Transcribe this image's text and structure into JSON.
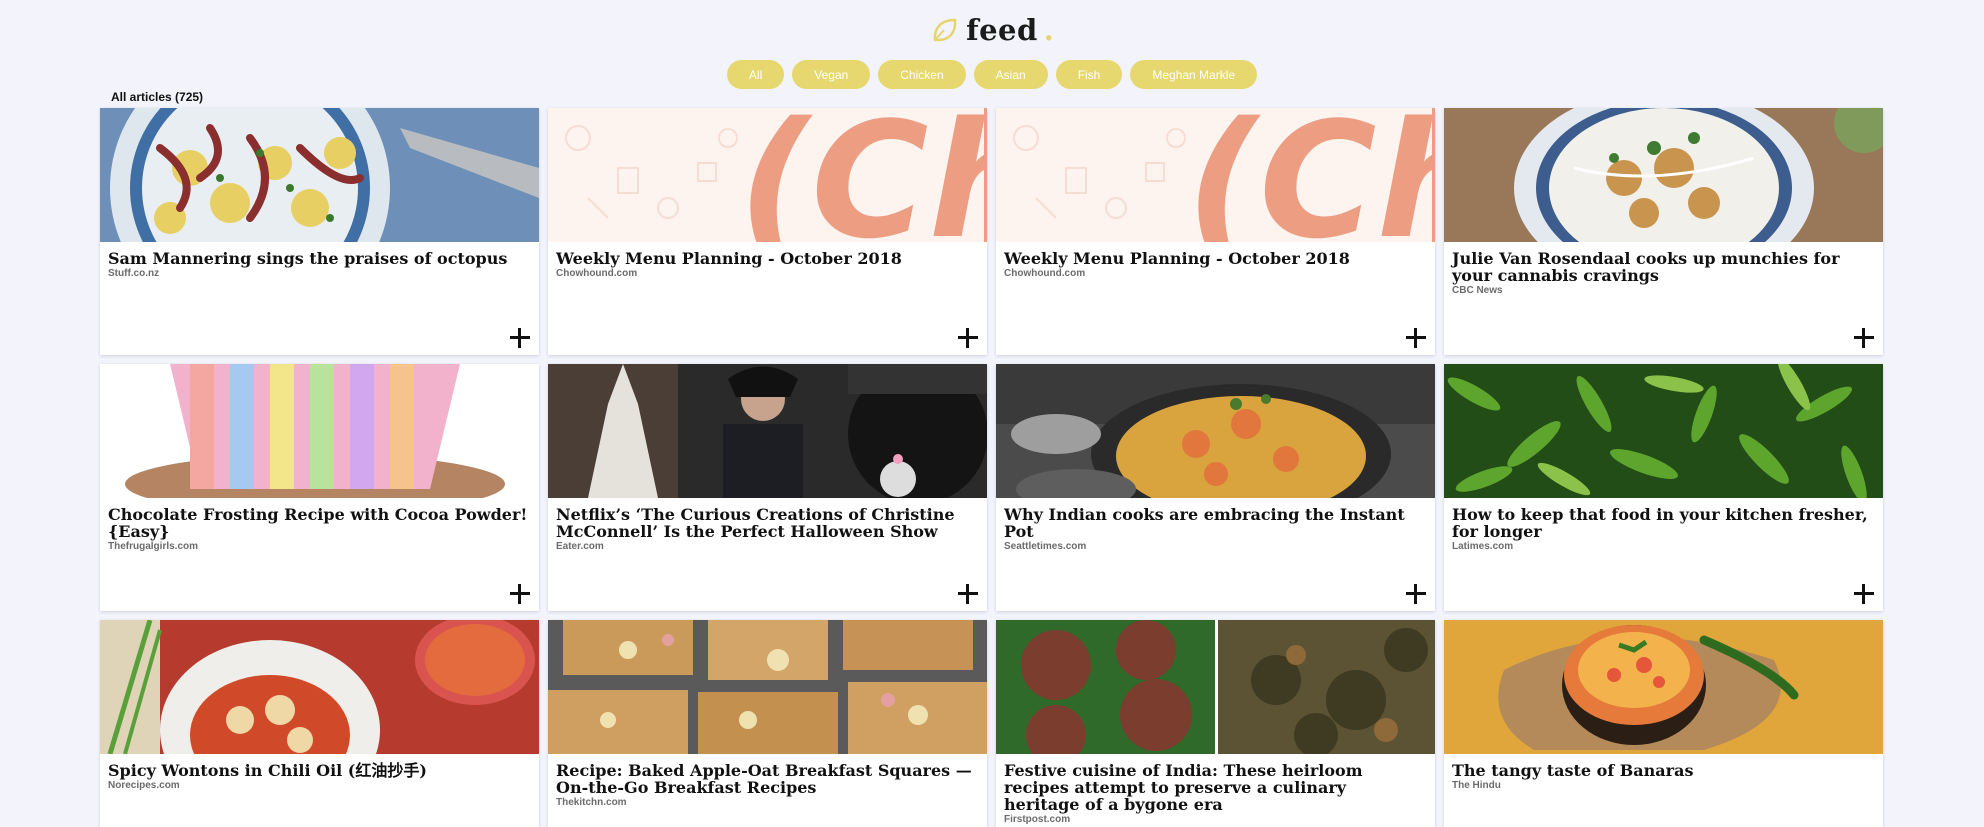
{
  "header": {
    "logo_text": "feed",
    "logo_dot": "."
  },
  "filters": [
    "All",
    "Vegan",
    "Chicken",
    "Asian",
    "Fish",
    "Meghan Markle"
  ],
  "article_count_label": "All articles (725)",
  "colors": {
    "accent": "#e6d86e",
    "background": "#f2f3fb",
    "card": "#ffffff"
  },
  "articles": [
    {
      "title": "Sam Mannering sings the praises of octopus",
      "source": "Stuff.co.nz",
      "image": "octopus-salad"
    },
    {
      "title": "Weekly Menu Planning - October 2018",
      "source": "Chowhound.com",
      "image": "chowhound-logo"
    },
    {
      "title": "Weekly Menu Planning - October 2018",
      "source": "Chowhound.com",
      "image": "chowhound-logo"
    },
    {
      "title": "Julie Van Rosendaal cooks up munchies for your cannabis cravings",
      "source": "CBC News",
      "image": "snack-plate"
    },
    {
      "title": "Chocolate Frosting Recipe with Cocoa Powder! {Easy}",
      "source": "Thefrugalgirls.com",
      "image": "cupcake-liners"
    },
    {
      "title": "Netflix’s ‘The Curious Creations of Christine McConnell’ Is the Perfect Halloween Show",
      "source": "Eater.com",
      "image": "dark-scene"
    },
    {
      "title": "Why Indian cooks are embracing the Instant Pot",
      "source": "Seattletimes.com",
      "image": "shrimp-rice"
    },
    {
      "title": "How to keep that food in your kitchen fresher, for longer",
      "source": "Latimes.com",
      "image": "green-peppers"
    },
    {
      "title": "Spicy Wontons in Chili Oil (红油抄手)",
      "source": "Norecipes.com",
      "image": "wontons"
    },
    {
      "title": "Recipe: Baked Apple-Oat Breakfast Squares — On-the-Go Breakfast Recipes",
      "source": "Thekitchn.com",
      "image": "oat-squares"
    },
    {
      "title": "Festive cuisine of India: These heirloom recipes attempt to preserve a culinary heritage of a bygone era",
      "source": "Firstpost.com",
      "image": "fritters"
    },
    {
      "title": "The tangy taste of Banaras",
      "source": "The Hindu",
      "image": "chutney-bowl"
    }
  ]
}
